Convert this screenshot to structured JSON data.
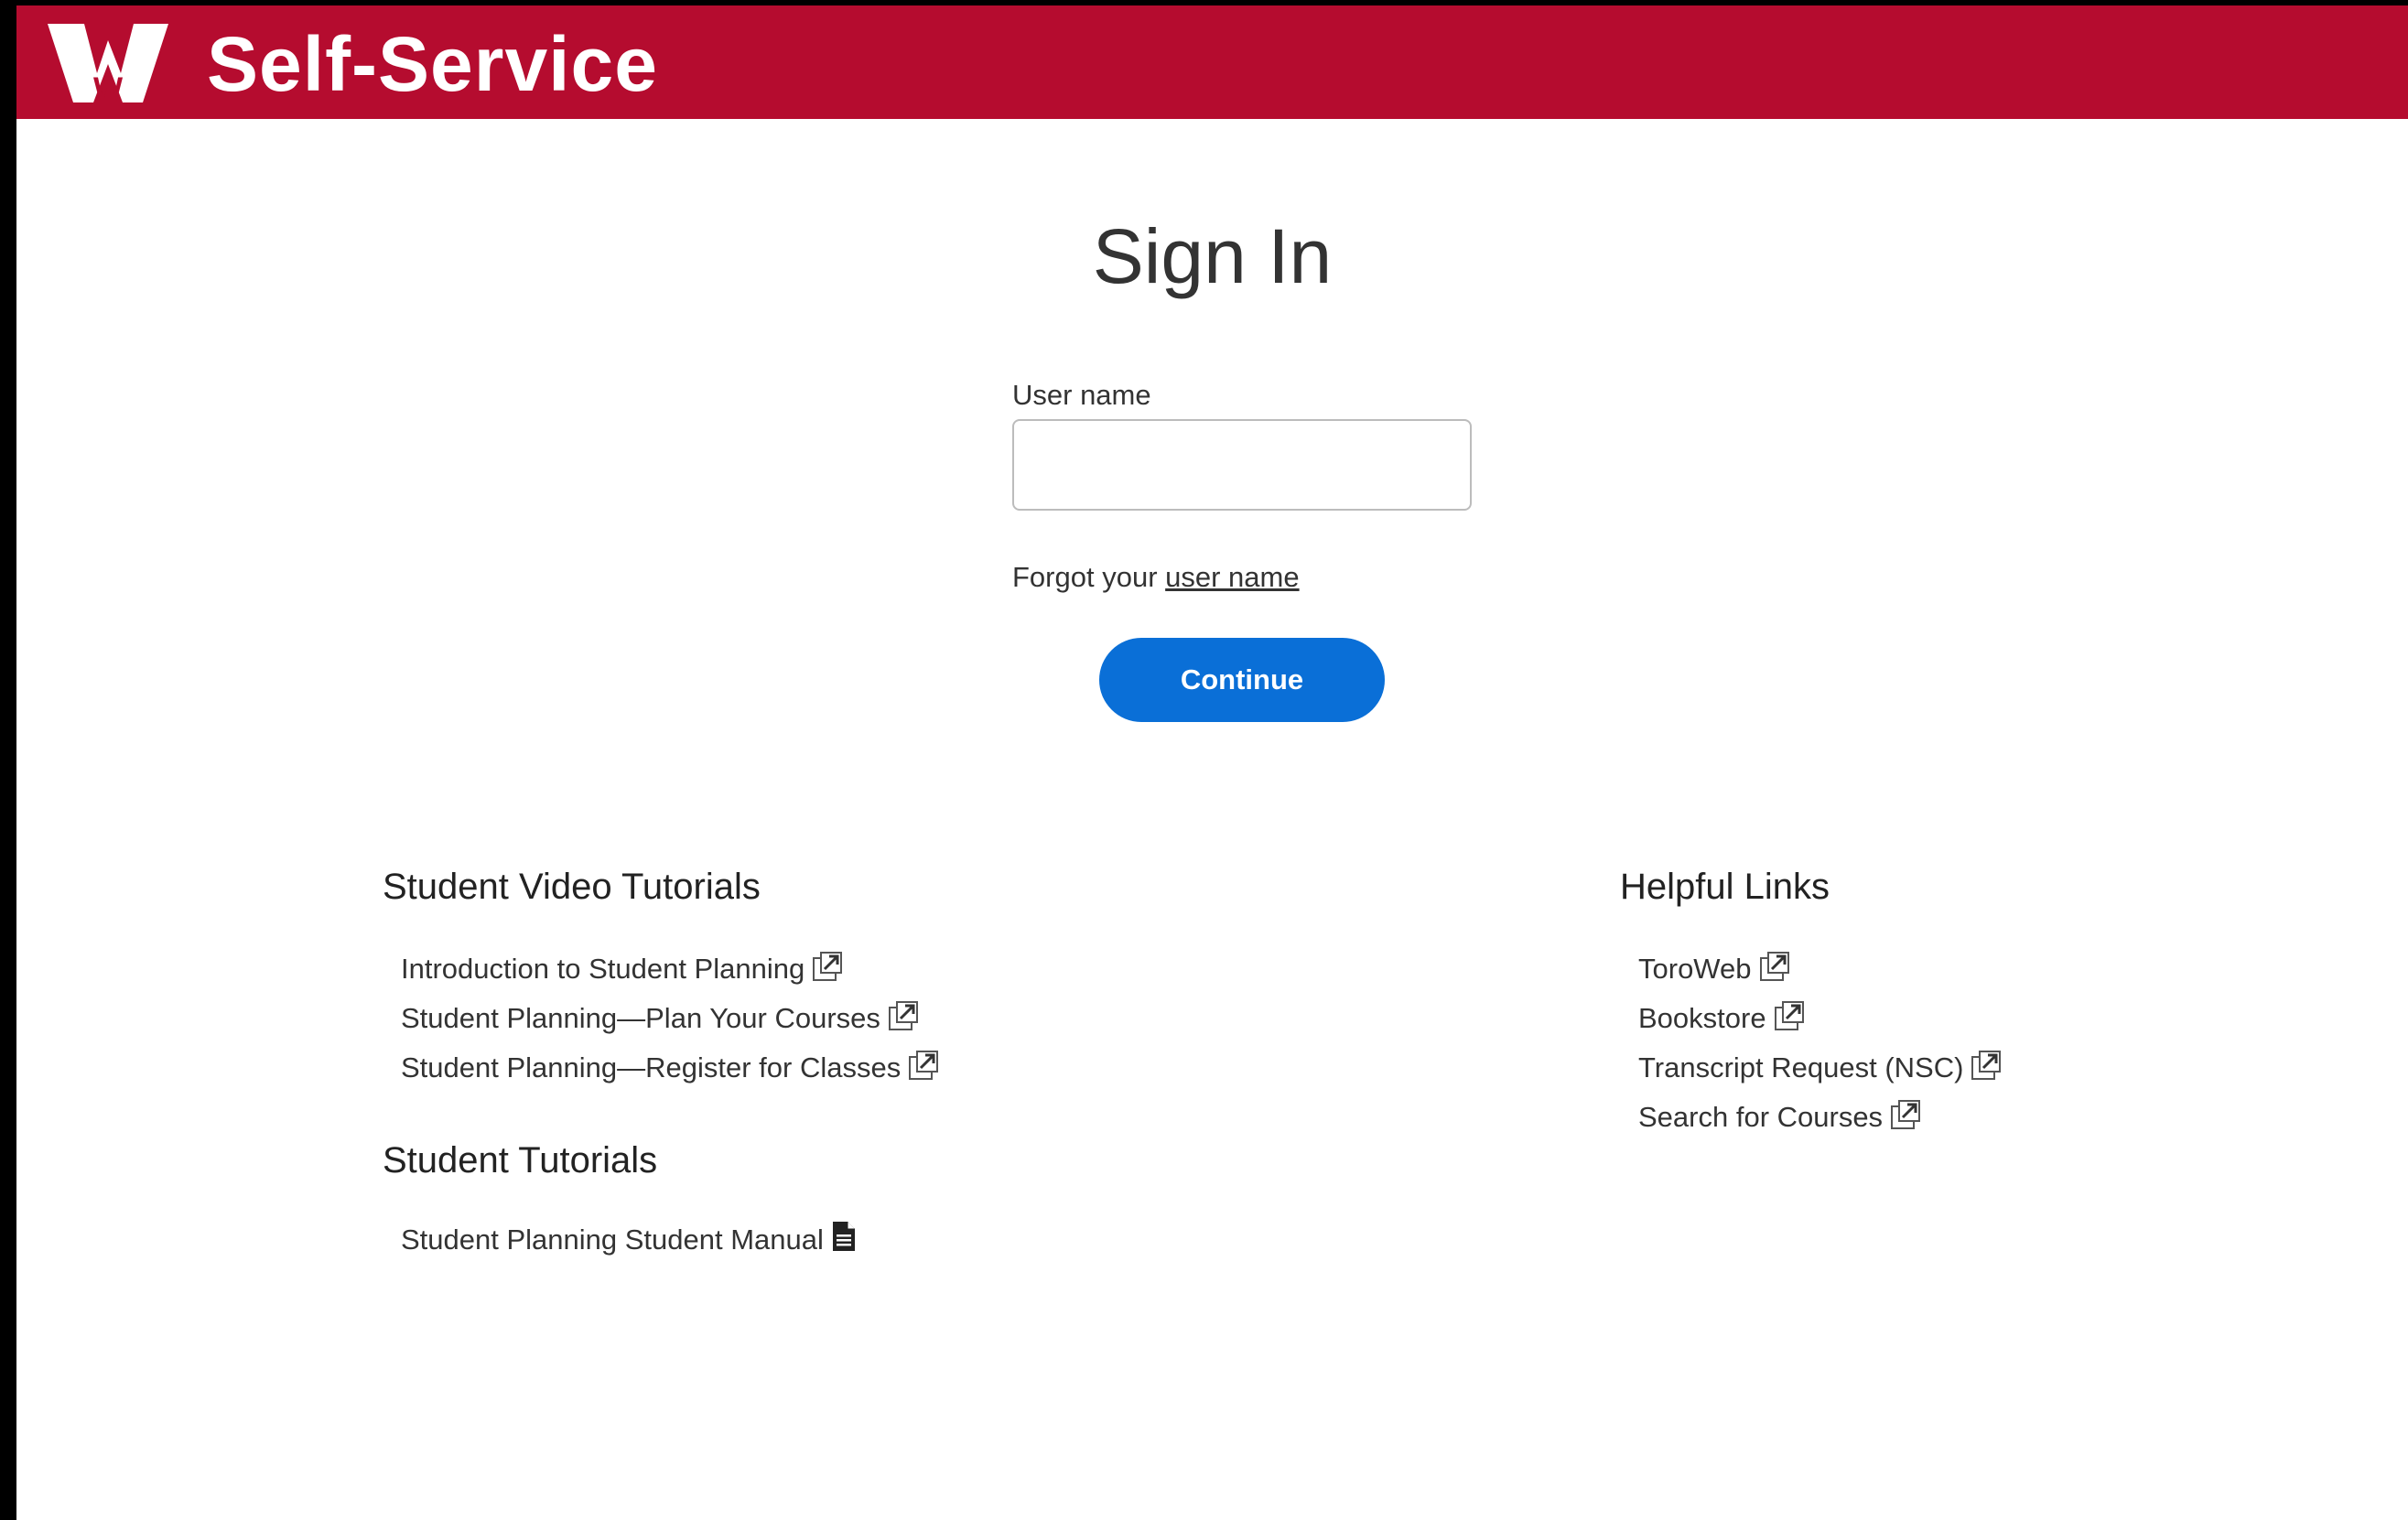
{
  "header": {
    "app_title": "Self-Service",
    "brand_color": "#b50c2f",
    "logo_text": "W"
  },
  "signin": {
    "title": "Sign In",
    "username_label": "User name",
    "username_value": "",
    "forgot_prefix": "Forgot your",
    "forgot_link": "user name",
    "continue_label": "Continue",
    "button_color": "#0a6fd7"
  },
  "video_tutorials": {
    "heading": "Student Video Tutorials",
    "items": [
      {
        "label": "Introduction to Student Planning",
        "icon": "external-link-icon"
      },
      {
        "label": "Student Planning—Plan Your Courses",
        "icon": "external-link-icon"
      },
      {
        "label": "Student Planning—Register for Classes",
        "icon": "external-link-icon"
      }
    ]
  },
  "student_tutorials": {
    "heading": "Student Tutorials",
    "items": [
      {
        "label": "Student Planning Student Manual",
        "icon": "document-icon"
      }
    ]
  },
  "helpful_links": {
    "heading": "Helpful Links",
    "items": [
      {
        "label": "ToroWeb",
        "icon": "external-link-icon"
      },
      {
        "label": "Bookstore",
        "icon": "external-link-icon"
      },
      {
        "label": "Transcript Request (NSC)",
        "icon": "external-link-icon"
      },
      {
        "label": "Search for Courses",
        "icon": "external-link-icon"
      }
    ]
  }
}
